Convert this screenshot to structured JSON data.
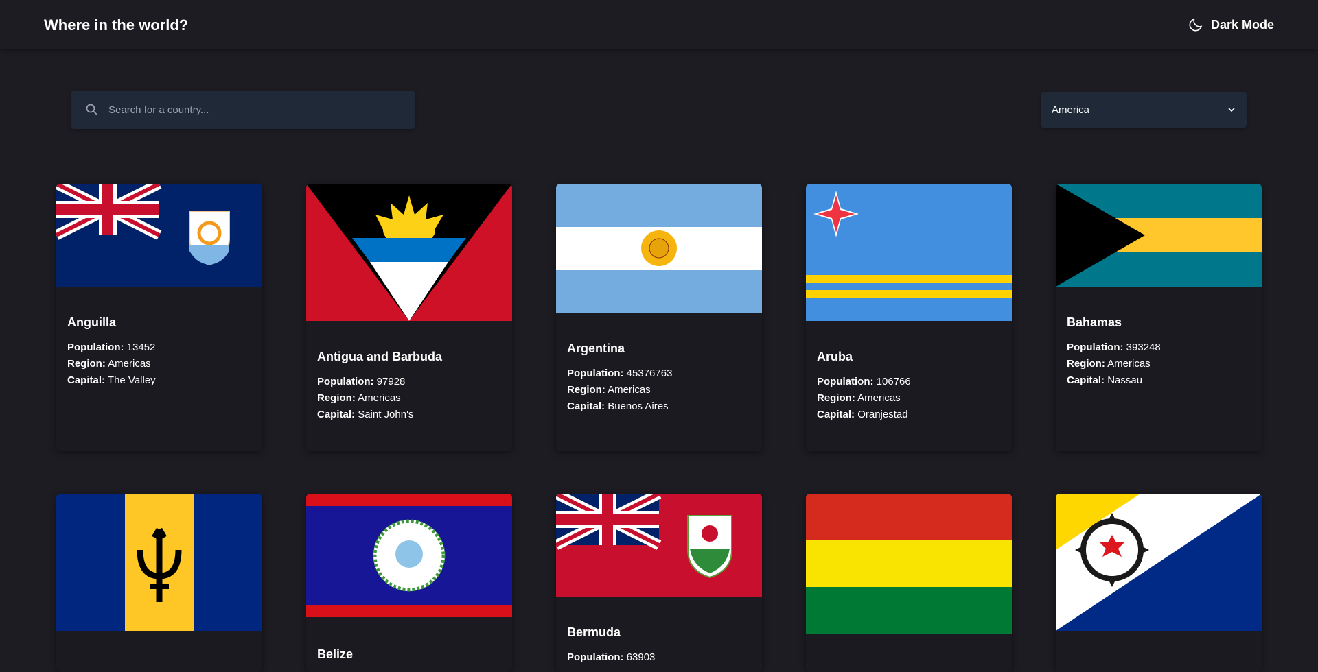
{
  "header": {
    "title": "Where in the world?",
    "mode_label": "Dark Mode"
  },
  "search": {
    "placeholder": "Search for a country..."
  },
  "filter": {
    "selected": "America"
  },
  "labels": {
    "population": "Population:",
    "region": "Region:",
    "capital": "Capital:"
  },
  "countries": [
    {
      "name": "Anguilla",
      "population": "13452",
      "region": "Americas",
      "capital": "The Valley"
    },
    {
      "name": "Antigua and Barbuda",
      "population": "97928",
      "region": "Americas",
      "capital": "Saint John's"
    },
    {
      "name": "Argentina",
      "population": "45376763",
      "region": "Americas",
      "capital": "Buenos Aires"
    },
    {
      "name": "Aruba",
      "population": "106766",
      "region": "Americas",
      "capital": "Oranjestad"
    },
    {
      "name": "Bahamas",
      "population": "393248",
      "region": "Americas",
      "capital": "Nassau"
    },
    {
      "name": "",
      "population": "",
      "region": "",
      "capital": ""
    },
    {
      "name": "Belize",
      "population": "",
      "region": "",
      "capital": ""
    },
    {
      "name": "Bermuda",
      "population": "63903",
      "region": "",
      "capital": ""
    },
    {
      "name": "",
      "population": "",
      "region": "",
      "capital": ""
    },
    {
      "name": "",
      "population": "",
      "region": "",
      "capital": ""
    }
  ],
  "flags": [
    "anguilla-flag",
    "antigua-and-barbuda-flag",
    "argentina-flag",
    "aruba-flag",
    "bahamas-flag",
    "barbados-flag",
    "belize-flag",
    "bermuda-flag",
    "bolivia-flag",
    "bonaire-flag"
  ],
  "colors": {
    "background": "#1d1c22",
    "header": "#1c1c22",
    "input": "#1f2937",
    "card": "#1a1a20",
    "text": "#ffffff"
  }
}
